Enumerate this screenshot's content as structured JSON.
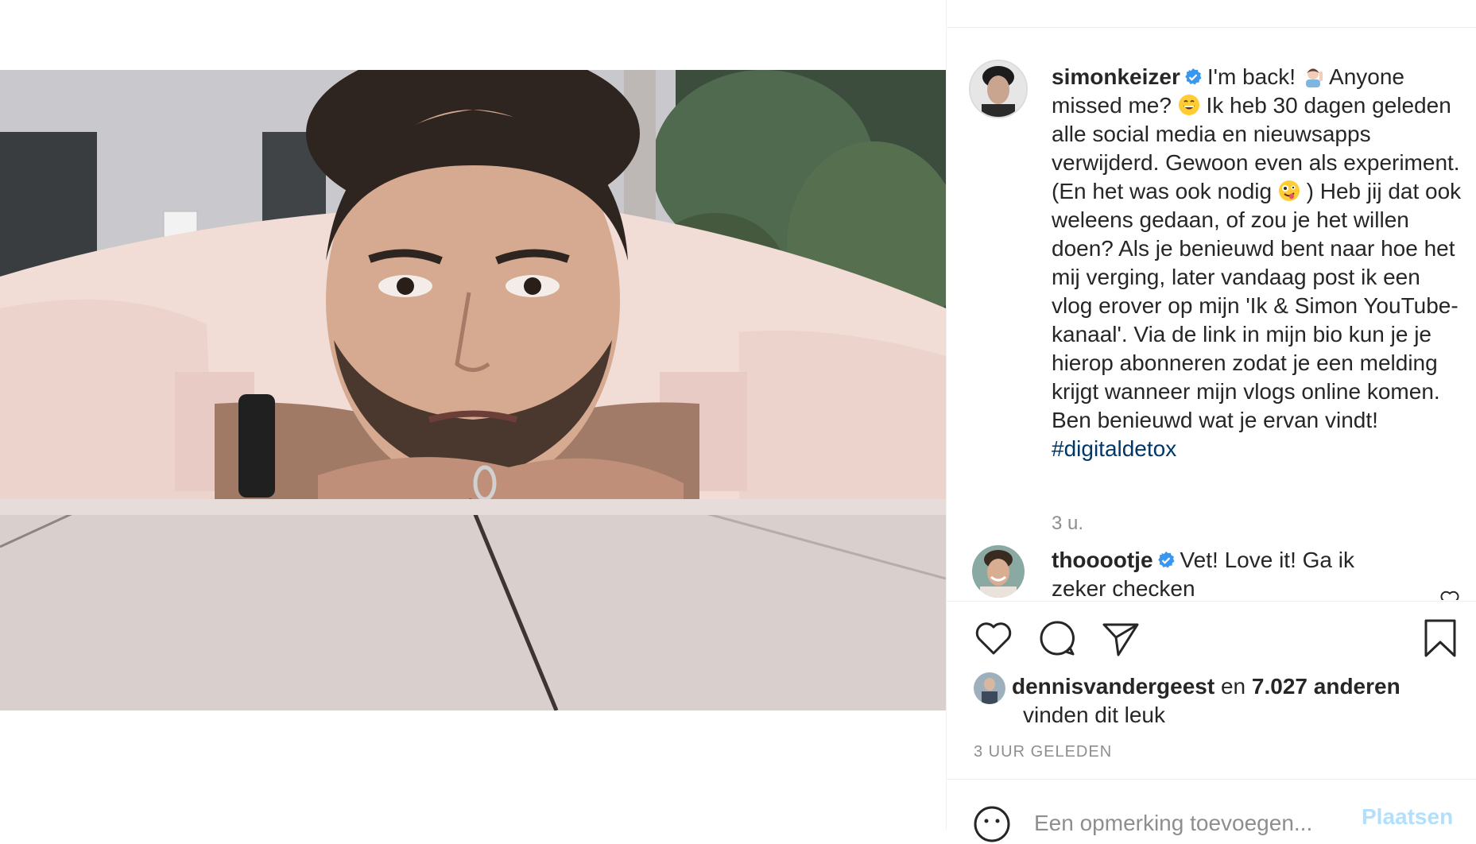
{
  "post": {
    "author": "simonkeizer",
    "caption_parts": {
      "a": "I'm back!",
      "b": "Anyone missed me?",
      "c": "Ik heb 30 dagen geleden alle social media en nieuwsapps verwijderd. Gewoon even als experiment. (En het was ook nodig",
      "d": ") Heb jij dat ook weleens gedaan, of zou je het willen doen? Als je benieuwd bent naar hoe het mij verging, later vandaag post ik een vlog erover op mijn 'Ik & Simon YouTube-kanaal'. Via de link in mijn bio kun je je hierop abonneren zodat je een melding krijgt wanneer mijn vlogs online komen. Ben benieuwd wat je ervan vindt!",
      "hashtag": "#digitaldetox"
    },
    "caption_time": "3 u.",
    "time_ago": "3 uur geleden"
  },
  "comments": [
    {
      "author": "thooootje",
      "text": "Vet! Love it! Ga ik zeker checken"
    }
  ],
  "likes": {
    "first_user": "dennisvandergeest",
    "connector": "en",
    "others": "7.027 anderen",
    "suffix": "vinden dit leuk"
  },
  "add_comment": {
    "placeholder": "Een opmerking toevoegen...",
    "post_label": "Plaatsen"
  },
  "icons": {
    "verified": "verified-badge-icon",
    "like": "heart-icon",
    "comment": "speech-bubble-icon",
    "share": "paper-plane-icon",
    "save": "bookmark-icon",
    "emoji": "smiley-icon"
  },
  "colors": {
    "verified_blue": "#3897f0",
    "hashtag": "#00376b",
    "muted": "#8e8e8e",
    "post_button_disabled": "#b2dffc"
  }
}
